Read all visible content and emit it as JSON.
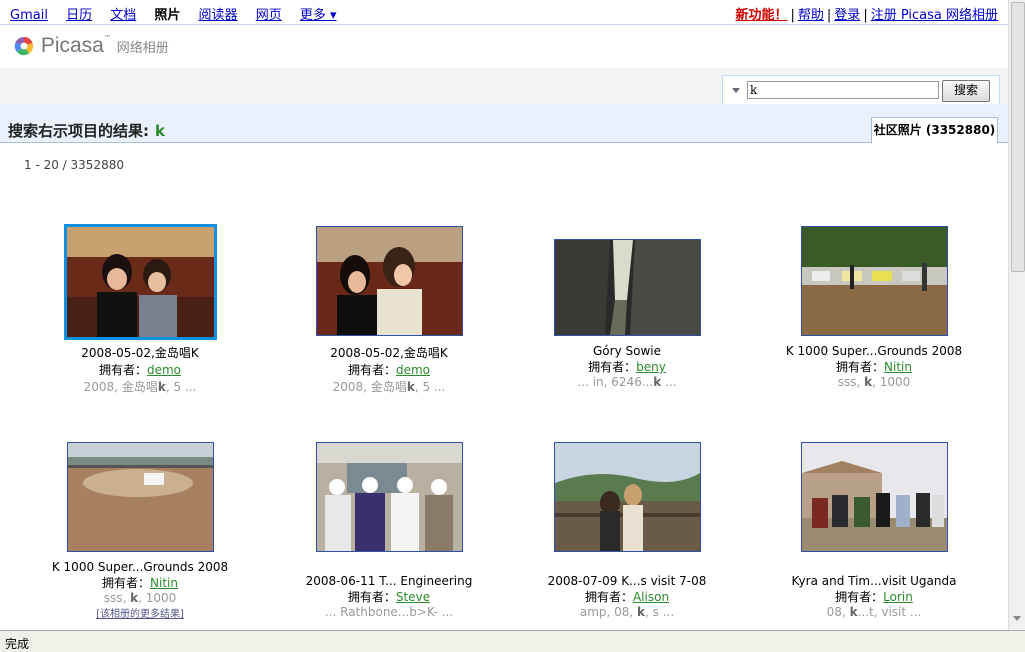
{
  "topnav": {
    "links": [
      "Gmail",
      "日历",
      "文档",
      "照片",
      "阅读器",
      "网页",
      "更多 ▾"
    ],
    "new_label": "新功能！",
    "help": "帮助",
    "signin": "登录",
    "register": "注册 Picasa 网络相册"
  },
  "logo": {
    "word": "Picasa",
    "tm": "™",
    "cn": "网络相册"
  },
  "search": {
    "value": "k",
    "button": "搜索"
  },
  "results": {
    "title": "搜索右示项目的结果:",
    "query": "k",
    "tab": "社区照片 (3352880)",
    "count": "1 - 20 / 3352880"
  },
  "owner_label": "拥有者：",
  "photos": [
    {
      "title": "2008-05-02,金岛唱K",
      "owner": "demo",
      "kw_pre": "2008, 金岛唱",
      "kw_bold": "k",
      "kw_post": ", 5 ..."
    },
    {
      "title": "2008-05-02,金岛唱K",
      "owner": "demo",
      "kw_pre": "2008, 金岛唱",
      "kw_bold": "k",
      "kw_post": ", 5 ..."
    },
    {
      "title": "Góry Sowie",
      "owner": "beny",
      "kw_pre": "... in, 6246...",
      "kw_bold": "k",
      "kw_post": " ..."
    },
    {
      "title": "K 1000 Super...Grounds 2008",
      "owner": "Nitin",
      "kw_pre": "sss, ",
      "kw_bold": "k",
      "kw_post": ", 1000"
    },
    {
      "title": "K 1000 Super...Grounds 2008",
      "owner": "Nitin",
      "kw_pre": "sss, ",
      "kw_bold": "k",
      "kw_post": ", 1000",
      "more": "[该相册的更多结果]"
    },
    {
      "title": "2008-06-11 T... Engineering",
      "owner": "Steve",
      "kw_pre": "... Rathbone...b>K- ...",
      "kw_bold": "",
      "kw_post": ""
    },
    {
      "title": "2008-07-09 K...s visit 7-08",
      "owner": "Alison",
      "kw_pre": "amp, 08, ",
      "kw_bold": "k",
      "kw_post": ", s ..."
    },
    {
      "title": "Kyra and Tim...visit Uganda",
      "owner": "Lorin",
      "kw_pre": "08, ",
      "kw_bold": "k",
      "kw_post": "...t, visit ..."
    }
  ],
  "status": "完成",
  "colors": {
    "accent_blue": "#0f91e0",
    "owner_green": "#2b8a2b",
    "new_red": "#cc0000"
  }
}
